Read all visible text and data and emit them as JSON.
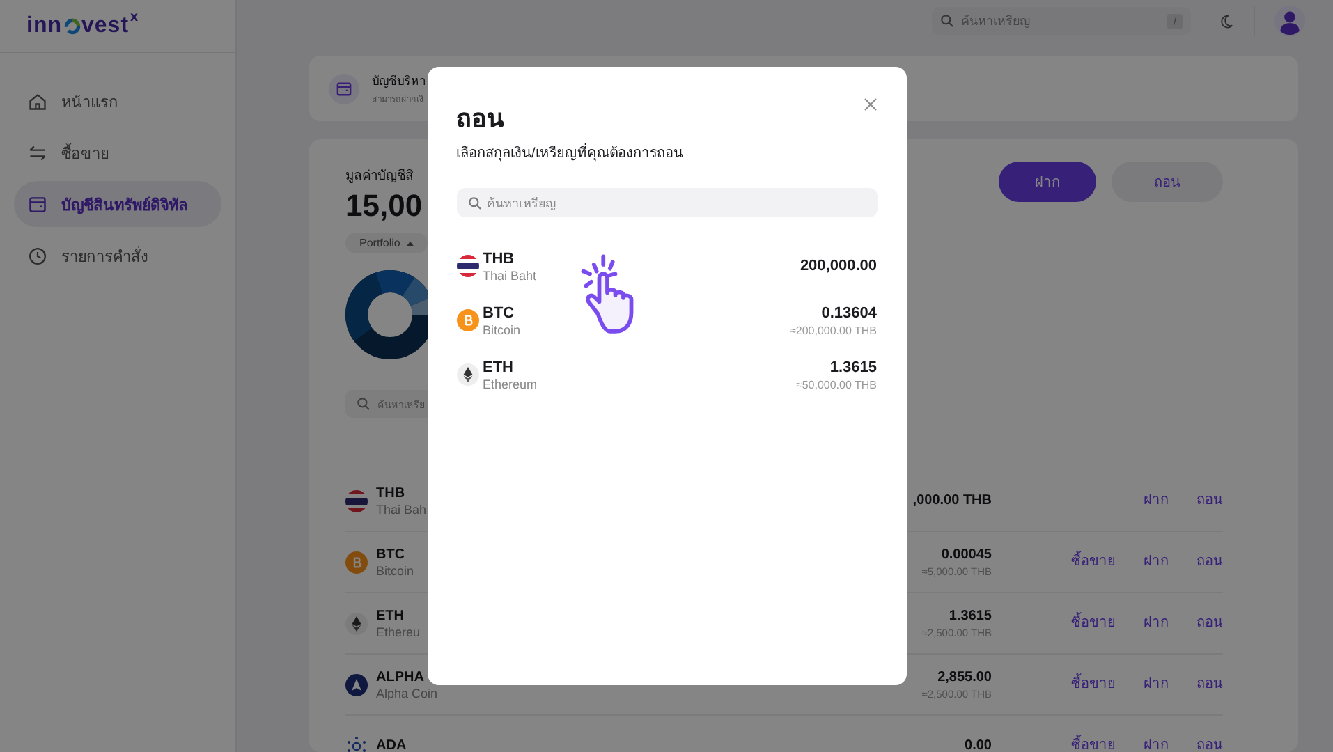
{
  "logo": {
    "before": "inn",
    "after": "vest",
    "mark": "x"
  },
  "header": {
    "search_placeholder": "ค้นหาเหรียญ",
    "shortcut": "/"
  },
  "sidebar": {
    "items": [
      {
        "label": "หน้าแรก",
        "kind": "home",
        "selected": false
      },
      {
        "label": "ซื้อขาย",
        "kind": "trade",
        "selected": false
      },
      {
        "label": "บัญชีสินทรัพย์ดิจิทัล",
        "kind": "wallet",
        "selected": true
      },
      {
        "label": "รายการคำสั่ง",
        "kind": "clock",
        "selected": false
      }
    ]
  },
  "info_card": {
    "title": "บัญชีบริหา",
    "subtitle": "สามารถฝากเงิ"
  },
  "portfolio": {
    "title": "มูลค่าบัญชีสิ",
    "value": "15,00",
    "filter": "Portfolio",
    "buttons": [
      {
        "label": "ฝาก",
        "kind": "primary"
      },
      {
        "label": "ถอน",
        "kind": "secondary"
      }
    ],
    "search_placeholder": "ค้นหาเหรีย",
    "assets": [
      {
        "kind": "thb",
        "symbol": "THB",
        "name": "Thai Bah",
        "amount": ",000.00 THB",
        "actions": [
          "ฝาก",
          "ถอน"
        ]
      },
      {
        "kind": "btc",
        "symbol": "BTC",
        "name": "Bitcoin",
        "amount": "0.00045",
        "equivalent": "≈5,000.00 THB",
        "actions": [
          "ซื้อขาย",
          "ฝาก",
          "ถอน"
        ]
      },
      {
        "kind": "eth",
        "symbol": "ETH",
        "name": "Ethereu",
        "amount": "1.3615",
        "equivalent": "≈2,500.00 THB",
        "actions": [
          "ซื้อขาย",
          "ฝาก",
          "ถอน"
        ]
      },
      {
        "kind": "alpha",
        "symbol": "ALPHA",
        "name": "Alpha Coin",
        "amount": "2,855.00",
        "equivalent": "≈2,500.00 THB",
        "actions": [
          "ซื้อขาย",
          "ฝาก",
          "ถอน"
        ]
      },
      {
        "kind": "ada",
        "symbol": "ADA",
        "amount": "0.00",
        "actions": [
          "ซื้อขาย",
          "ฝาก",
          "ถอน"
        ]
      }
    ]
  },
  "modal": {
    "title": "ถอน",
    "subtitle": "เลือกสกุลเงิน/เหรียญที่คุณต้องการถอน",
    "search_placeholder": "ค้นหาเหรียญ",
    "items": [
      {
        "kind": "thb",
        "symbol": "THB",
        "name": "Thai Baht",
        "amount": "200,000.00"
      },
      {
        "kind": "btc",
        "symbol": "BTC",
        "name": "Bitcoin",
        "amount": "0.13604",
        "equivalent": "≈200,000.00 THB"
      },
      {
        "kind": "eth",
        "symbol": "ETH",
        "name": "Ethereum",
        "amount": "1.3615",
        "equivalent": "≈50,000.00 THB"
      }
    ]
  }
}
